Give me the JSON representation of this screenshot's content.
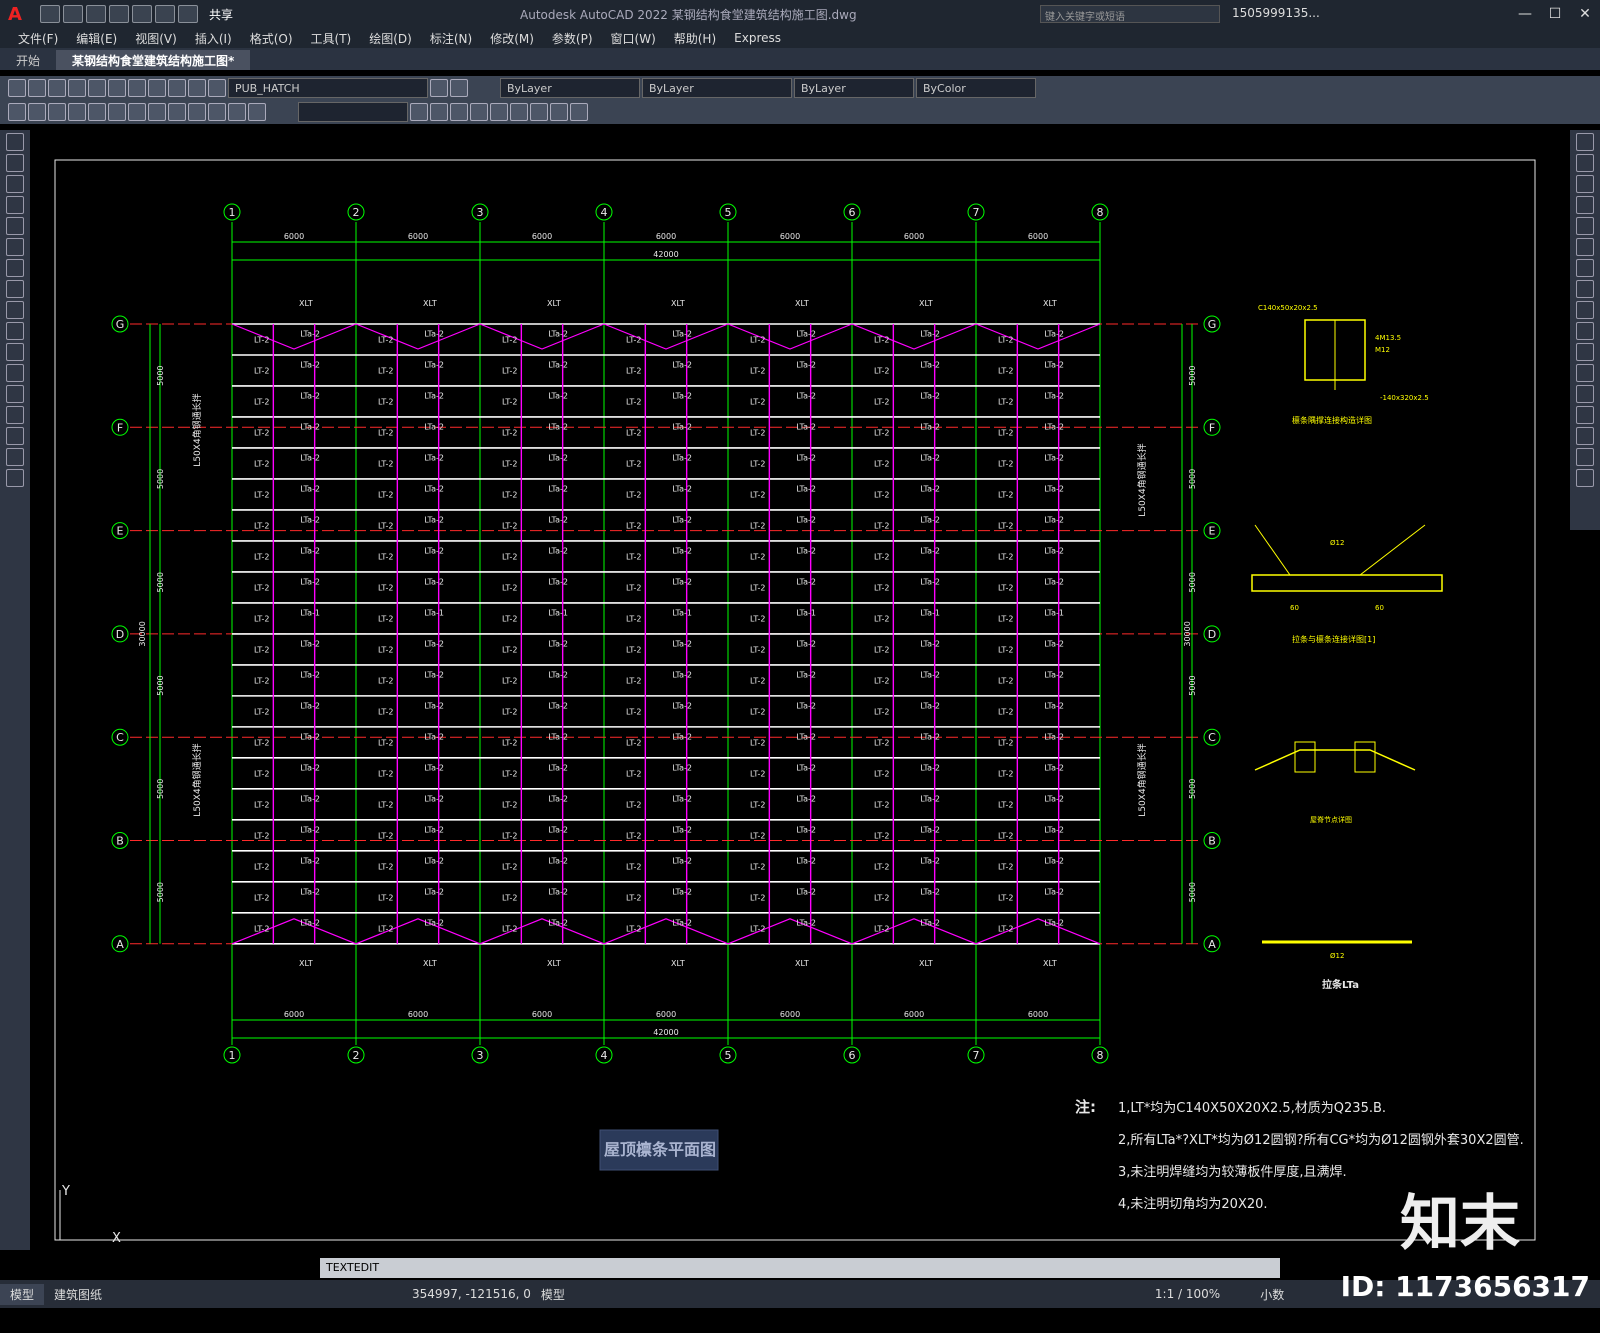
{
  "titlebar": {
    "title": "Autodesk AutoCAD 2022    某钢结构食堂建筑结构施工图.dwg",
    "search_placeholder": "键入关键字或短语",
    "user": "1505999135...",
    "share_label": "共享"
  },
  "menubar": {
    "items": [
      "文件(F)",
      "编辑(E)",
      "视图(V)",
      "插入(I)",
      "格式(O)",
      "工具(T)",
      "绘图(D)",
      "标注(N)",
      "修改(M)",
      "参数(P)",
      "窗口(W)",
      "帮助(H)",
      "Express"
    ]
  },
  "tabs": [
    {
      "label": "开始"
    },
    {
      "label": "某钢结构食堂建筑结构施工图*"
    }
  ],
  "toolbar": {
    "layer": "PUB_HATCH",
    "color": "ByLayer",
    "linetype": "ByLayer",
    "lineweight": "ByLayer",
    "plotstyle": "ByColor"
  },
  "drawing": {
    "axes_numbers": [
      "1",
      "2",
      "3",
      "4",
      "5",
      "6",
      "7",
      "8"
    ],
    "axes_letters": [
      "G",
      "F",
      "E",
      "D",
      "C",
      "B",
      "A"
    ],
    "bay_dim": "6000",
    "total_width": "42000",
    "span_dim": "5000",
    "total_height": "30000",
    "bracing_label_top": "L50X4角钢通长拌",
    "bracing_label_bottom": "L50X4角钢通长拌",
    "labels": {
      "xlt": "XLT",
      "lt2": "LT-2",
      "lta2": "LTa-2",
      "lta1": "LTa-1",
      "cg": "CG"
    },
    "plan_title": "屋顶檩条平面图",
    "detail1_label": "檩条隅撑连接构造详图",
    "detail2_label": "拉条与檩条连接详图[1]",
    "detail3_label": "屋脊节点详图",
    "detail4_label": "拉条LTa",
    "detail1_note_a": "C140x50x20x2.5",
    "detail1_note_b": "4M13.5",
    "detail1_note_c": "M12",
    "detail1_note_d": "-140x320x2.5",
    "detail2_note": "Ø12",
    "detail4_note": "Ø12",
    "dim60": "60",
    "notes_header": "注:",
    "notes": [
      "1,LT*均为C140X50X20X2.5,材质为Q235.B.",
      "2,所有LTa*?XLT*均为Ø12圆钢?所有CG*均为Ø12圆钢外套30X2圆管.",
      "3,未注明焊缝均为较薄板件厚度,且满焊.",
      "4,未注明切角均为20X20."
    ],
    "ucs_x": "X",
    "ucs_y": "Y"
  },
  "command": {
    "text": "TEXTEDIT"
  },
  "status": {
    "model_tab": "模型",
    "layout_tab": "建筑图纸",
    "coords": "354997, -121516, 0",
    "mode": "模型",
    "scale": "1:1 / 100%",
    "units": "小数"
  },
  "watermark": {
    "logo": "知末",
    "id": "ID: 1173656317"
  },
  "colors": {
    "grid": "#00ff00",
    "beam": "#ffffff",
    "brace": "#ff00ff",
    "axis": "#ff2a2a",
    "detail": "#ffff00",
    "text_light": "#e8e8e8"
  }
}
